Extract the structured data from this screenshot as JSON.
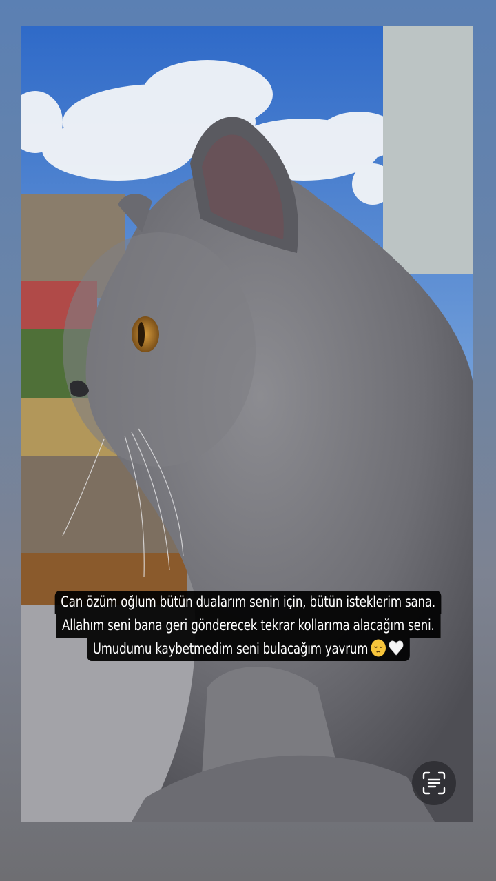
{
  "story": {
    "caption_lines": [
      "Can özüm oğlum bütün dualarım senin için, bütün isteklerim sana.",
      "Allahım seni bana geri gönderecek tekrar kollarıma alacağım seni.",
      "Umudumu kaybetmedim seni bulacağım yavrum"
    ],
    "caption_emojis": [
      "pensive-face",
      "white-heart"
    ],
    "photo_subject": "gray-cat",
    "text_button_icon": "text-lines-icon"
  },
  "colors": {
    "caption_bg": "#000000",
    "caption_text": "#ffffff",
    "background_top": "#5b80b3",
    "background_bottom": "#6e6e72"
  }
}
